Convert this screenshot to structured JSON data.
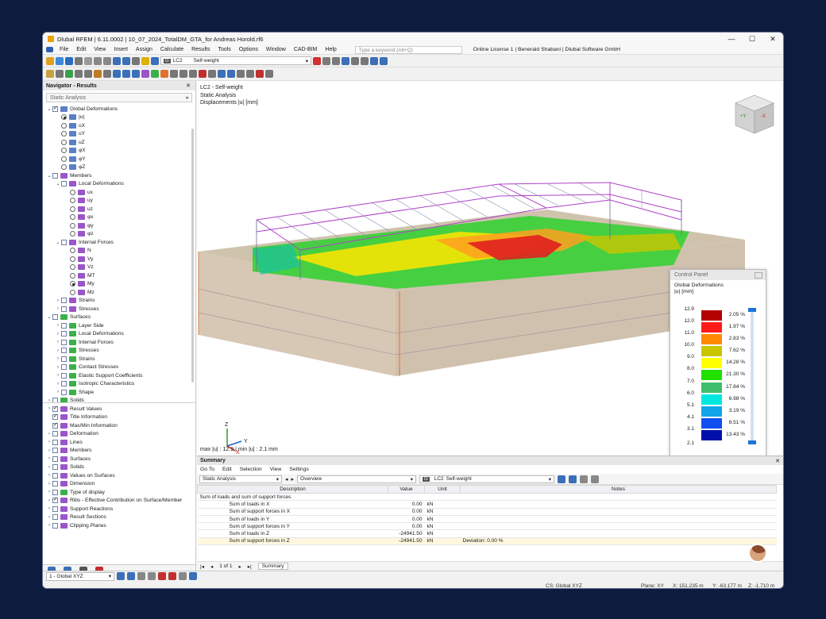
{
  "app": {
    "title": "Dlubal RFEM | 6.11.0002 | 10_07_2024_TotalDM_GTA_for Andreas Horold.rf6",
    "window_controls": [
      "—",
      "☐",
      "✕"
    ]
  },
  "menu": {
    "items": [
      "File",
      "Edit",
      "View",
      "Insert",
      "Assign",
      "Calculate",
      "Results",
      "Tools",
      "Options",
      "Window",
      "CAD-BIM",
      "Help"
    ],
    "search_placeholder": "Type a keyword (Alt+Q)",
    "license": "Online License 1 | Benerald Shabani | Dlubal Software GmbH"
  },
  "toolbar": {
    "loadcase_badge": "G",
    "loadcase_id": "LC2",
    "loadcase_name": "Self-weight"
  },
  "navigator": {
    "title": "Navigator - Results",
    "analysis": "Static Analysis",
    "tree": [
      {
        "level": 0,
        "arrow": "v",
        "check": "on",
        "icon": "#5a7fc8",
        "label": "Global Deformations"
      },
      {
        "level": 1,
        "radio": "on",
        "icon": "#5a7fc8",
        "label": "|u|"
      },
      {
        "level": 1,
        "radio": "off",
        "icon": "#5a7fc8",
        "label": "uX"
      },
      {
        "level": 1,
        "radio": "off",
        "icon": "#5a7fc8",
        "label": "uY"
      },
      {
        "level": 1,
        "radio": "off",
        "icon": "#5a7fc8",
        "label": "uZ"
      },
      {
        "level": 1,
        "radio": "off",
        "icon": "#5a7fc8",
        "label": "φX"
      },
      {
        "level": 1,
        "radio": "off",
        "icon": "#5a7fc8",
        "label": "φY"
      },
      {
        "level": 1,
        "radio": "off",
        "icon": "#5a7fc8",
        "label": "φZ"
      },
      {
        "level": 0,
        "arrow": "v",
        "check": "off",
        "icon": "#9a55c8",
        "label": "Members"
      },
      {
        "level": 1,
        "arrow": "v",
        "check": "off",
        "icon": "#9a55c8",
        "label": "Local Deformations"
      },
      {
        "level": 2,
        "radio": "off",
        "icon": "#9a55c8",
        "label": "ux"
      },
      {
        "level": 2,
        "radio": "off",
        "icon": "#9a55c8",
        "label": "uy"
      },
      {
        "level": 2,
        "radio": "off",
        "icon": "#9a55c8",
        "label": "uz"
      },
      {
        "level": 2,
        "radio": "off",
        "icon": "#9a55c8",
        "label": "φx"
      },
      {
        "level": 2,
        "radio": "off",
        "icon": "#9a55c8",
        "label": "φy"
      },
      {
        "level": 2,
        "radio": "off",
        "icon": "#9a55c8",
        "label": "φz"
      },
      {
        "level": 1,
        "arrow": "v",
        "check": "off",
        "icon": "#9a55c8",
        "label": "Internal Forces"
      },
      {
        "level": 2,
        "radio": "off",
        "icon": "#9a55c8",
        "label": "N"
      },
      {
        "level": 2,
        "radio": "off",
        "icon": "#9a55c8",
        "label": "Vy"
      },
      {
        "level": 2,
        "radio": "off",
        "icon": "#9a55c8",
        "label": "Vz"
      },
      {
        "level": 2,
        "radio": "off",
        "icon": "#9a55c8",
        "label": "MT"
      },
      {
        "level": 2,
        "radio": "on",
        "icon": "#9a55c8",
        "label": "My"
      },
      {
        "level": 2,
        "radio": "off",
        "icon": "#9a55c8",
        "label": "Mz"
      },
      {
        "level": 1,
        "arrow": ">",
        "check": "off",
        "icon": "#9a55c8",
        "label": "Strains"
      },
      {
        "level": 1,
        "arrow": ">",
        "check": "off",
        "icon": "#9a55c8",
        "label": "Stresses"
      },
      {
        "level": 0,
        "arrow": "v",
        "check": "off",
        "icon": "#3bb04a",
        "label": "Surfaces"
      },
      {
        "level": 1,
        "arrow": ">",
        "check": "off",
        "icon": "#3bb04a",
        "label": "Layer Side"
      },
      {
        "level": 1,
        "arrow": ">",
        "check": "off",
        "icon": "#3bb04a",
        "label": "Local Deformations"
      },
      {
        "level": 1,
        "arrow": ">",
        "check": "off",
        "icon": "#3bb04a",
        "label": "Internal Forces"
      },
      {
        "level": 1,
        "arrow": ">",
        "check": "off",
        "icon": "#3bb04a",
        "label": "Stresses"
      },
      {
        "level": 1,
        "arrow": ">",
        "check": "off",
        "icon": "#3bb04a",
        "label": "Strains"
      },
      {
        "level": 1,
        "arrow": ">",
        "check": "off",
        "icon": "#3bb04a",
        "label": "Contact Stresses"
      },
      {
        "level": 1,
        "arrow": ">",
        "check": "off",
        "icon": "#3bb04a",
        "label": "Elastic Support Coefficients"
      },
      {
        "level": 1,
        "arrow": ">",
        "check": "off",
        "icon": "#3bb04a",
        "label": "Isotropic Characteristics"
      },
      {
        "level": 1,
        "arrow": ">",
        "check": "off",
        "icon": "#3bb04a",
        "label": "Shape"
      },
      {
        "level": 0,
        "arrow": ">",
        "check": "off",
        "icon": "#3bb04a",
        "label": "Solids"
      }
    ],
    "tree2": [
      {
        "arrow": ">",
        "check": "on",
        "icon": "#9a55c8",
        "label": "Result Values"
      },
      {
        "arrow": "",
        "check": "on",
        "icon": "#9a55c8",
        "label": "Title Information"
      },
      {
        "arrow": "",
        "check": "on",
        "icon": "#9a55c8",
        "label": "Max/Min Information"
      },
      {
        "arrow": ">",
        "check": "off",
        "icon": "#9a55c8",
        "label": "Deformation"
      },
      {
        "arrow": ">",
        "check": "off",
        "icon": "#9a55c8",
        "label": "Lines"
      },
      {
        "arrow": ">",
        "check": "off",
        "icon": "#9a55c8",
        "label": "Members"
      },
      {
        "arrow": ">",
        "check": "off",
        "icon": "#9a55c8",
        "label": "Surfaces"
      },
      {
        "arrow": ">",
        "check": "off",
        "icon": "#9a55c8",
        "label": "Solids"
      },
      {
        "arrow": ">",
        "check": "off",
        "icon": "#9a55c8",
        "label": "Values on Surfaces"
      },
      {
        "arrow": ">",
        "check": "off",
        "icon": "#9a55c8",
        "label": "Dimension"
      },
      {
        "arrow": ">",
        "check": "off",
        "icon": "#3bb04a",
        "label": "Type of display"
      },
      {
        "arrow": ">",
        "check": "on",
        "icon": "#9a55c8",
        "label": "Ribs - Effective Contribution on Surface/Member"
      },
      {
        "arrow": ">",
        "check": "off",
        "icon": "#9a55c8",
        "label": "Support Reactions"
      },
      {
        "arrow": ">",
        "check": "off",
        "icon": "#9a55c8",
        "label": "Result Sections"
      },
      {
        "arrow": ">",
        "check": "off",
        "icon": "#9a55c8",
        "label": "Clipping Planes"
      }
    ]
  },
  "viewport": {
    "line1": "LC2 - Self-weight",
    "line2": "Static Analysis",
    "line3": "Displacements |u| [mm]",
    "maxmin": "max |u| : 12.9 | min |u| : 2.1 mm",
    "cube_left": "+Y",
    "cube_right": "-X",
    "axis_z": "Z",
    "axis_y": "Y",
    "axis_x": "X"
  },
  "control_panel": {
    "title": "Control Panel",
    "subtitle": "Global Deformations",
    "unit": "|u| [mm]",
    "scale": [
      {
        "value": "12.9",
        "color": "#b30000",
        "pct": "2.05 %"
      },
      {
        "value": "12.0",
        "color": "#ff1a1a",
        "pct": "1.97 %"
      },
      {
        "value": "11.0",
        "color": "#ff8a00",
        "pct": "2.83 %"
      },
      {
        "value": "10.0",
        "color": "#c9c600",
        "pct": "7.62 %"
      },
      {
        "value": "9.0",
        "color": "#ffff00",
        "pct": "14.28 %"
      },
      {
        "value": "8.0",
        "color": "#22e000",
        "pct": "21.30 %"
      },
      {
        "value": "7.0",
        "color": "#3fbe6c",
        "pct": "17.84 %"
      },
      {
        "value": "6.0",
        "color": "#00e8e0",
        "pct": "6.98 %"
      },
      {
        "value": "5.1",
        "color": "#12a6e8",
        "pct": "3.19 %"
      },
      {
        "value": "4.1",
        "color": "#1050f0",
        "pct": "8.51 %"
      },
      {
        "value": "3.1",
        "color": "#0010a8",
        "pct": "13.43 %"
      }
    ],
    "scale_min": "2.1"
  },
  "summary": {
    "title": "Summary",
    "menu": [
      "Go To",
      "Edit",
      "Selection",
      "View",
      "Settings"
    ],
    "analysis": "Static Analysis",
    "overview": "Overview",
    "lc_badge": "G",
    "lc_id": "LC2",
    "lc_name": "Self-weight",
    "columns": [
      "Description",
      "Value",
      "Unit",
      "Notes"
    ],
    "group": "Sum of loads and sum of support forces",
    "rows": [
      {
        "desc": "Sum of loads in X",
        "value": "0.00",
        "unit": "kN",
        "notes": ""
      },
      {
        "desc": "Sum of support forces in X",
        "value": "0.00",
        "unit": "kN",
        "notes": ""
      },
      {
        "desc": "Sum of loads in Y",
        "value": "0.00",
        "unit": "kN",
        "notes": ""
      },
      {
        "desc": "Sum of support forces in Y",
        "value": "0.00",
        "unit": "kN",
        "notes": ""
      },
      {
        "desc": "Sum of loads in Z",
        "value": "-24941.50",
        "unit": "kN",
        "notes": ""
      },
      {
        "desc": "Sum of support forces in Z",
        "value": "-24941.50",
        "unit": "kN",
        "notes": "Deviation: 0.00 %"
      }
    ],
    "pager": "1 of 1",
    "tab": "Summary"
  },
  "statusbar": {
    "view": "1 - Global XYZ",
    "cs": "CS: Global XYZ",
    "plane": "Plane: XY",
    "x": "X: 151.235 m",
    "y": "Y: -63.177 m",
    "z": "Z: -1.710 m"
  }
}
